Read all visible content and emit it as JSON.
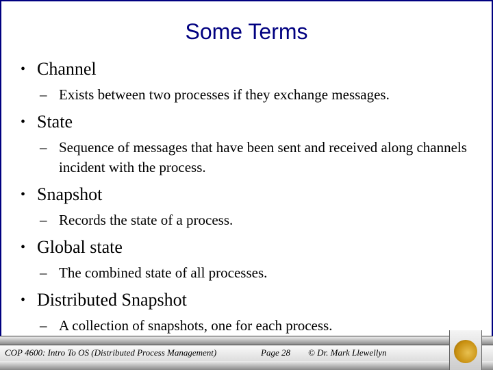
{
  "slide": {
    "title": "Some Terms",
    "items": [
      {
        "term": "Channel",
        "desc": "Exists between two processes if they exchange messages."
      },
      {
        "term": "State",
        "desc": "Sequence of messages that have been sent and received along channels incident with the process."
      },
      {
        "term": "Snapshot",
        "desc": "Records the state of a process."
      },
      {
        "term": "Global state",
        "desc": "The combined state of all processes."
      },
      {
        "term": "Distributed Snapshot",
        "desc": "A collection of snapshots, one for each process."
      }
    ],
    "bullet": "•",
    "dash": "–"
  },
  "footer": {
    "course": "COP 4600: Intro To OS  (Distributed Process Management)",
    "page": "Page 28",
    "author": "© Dr. Mark Llewellyn",
    "logo_icon": "ucf-pegasus-logo"
  },
  "colors": {
    "title": "#000080",
    "border": "#000080",
    "logo_gold": "#c89010"
  }
}
